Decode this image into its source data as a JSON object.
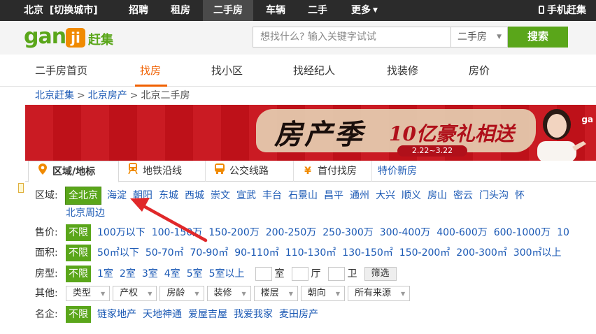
{
  "topbar": {
    "city": "北京",
    "switch_city": "[切换城市]",
    "nav": [
      "招聘",
      "租房",
      "二手房",
      "车辆",
      "二手",
      "更多"
    ],
    "active": "二手房",
    "mobile": "手机赶集"
  },
  "header": {
    "logo_gan": "gan",
    "logo_ji": "ji",
    "logo_name": "赶集",
    "search_placeholder": "想找什么? 输入关键字试试",
    "search_category": "二手房",
    "search_button": "搜索"
  },
  "subnav": {
    "items": [
      "二手房首页",
      "找房",
      "找小区",
      "找经纪人",
      "找装修",
      "房价"
    ],
    "active": "找房"
  },
  "breadcrumb": [
    "北京赶集",
    "北京房产",
    "北京二手房"
  ],
  "banner": {
    "title": "房产季",
    "subtitle": "10亿豪礼相送",
    "dates": "2.22~3.22",
    "brand": "ga"
  },
  "filter_tabs": [
    {
      "label": "区域/地标",
      "icon": "location-pin-icon"
    },
    {
      "label": "地铁沿线",
      "icon": "subway-icon"
    },
    {
      "label": "公交线路",
      "icon": "bus-icon"
    },
    {
      "label": "首付找房",
      "icon": "yen-icon"
    },
    {
      "label": "特价新房",
      "icon": ""
    }
  ],
  "filters": {
    "district": {
      "label": "区域:",
      "selected": "全北京",
      "options": [
        "海淀",
        "朝阳",
        "东城",
        "西城",
        "崇文",
        "宣武",
        "丰台",
        "石景山",
        "昌平",
        "通州",
        "大兴",
        "顺义",
        "房山",
        "密云",
        "门头沟",
        "怀"
      ],
      "extra": "北京周边"
    },
    "price": {
      "label": "售价:",
      "selected": "不限",
      "options": [
        "100万以下",
        "100-150万",
        "150-200万",
        "200-250万",
        "250-300万",
        "300-400万",
        "400-600万",
        "600-1000万",
        "10"
      ]
    },
    "area": {
      "label": "面积:",
      "selected": "不限",
      "options": [
        "50㎡以下",
        "50-70㎡",
        "70-90㎡",
        "90-110㎡",
        "110-130㎡",
        "130-150㎡",
        "150-200㎡",
        "200-300㎡",
        "300㎡以上"
      ]
    },
    "layout": {
      "label": "房型:",
      "selected": "不限",
      "options": [
        "1室",
        "2室",
        "3室",
        "4室",
        "5室",
        "5室以上"
      ],
      "room_unit": "室",
      "hall_unit": "厅",
      "bath_unit": "卫",
      "filter_button": "筛选"
    },
    "other": {
      "label": "其他:",
      "dropdowns": [
        "类型",
        "产权",
        "房龄",
        "装修",
        "楼层",
        "朝向",
        "所有来源"
      ]
    },
    "agency": {
      "label": "名企:",
      "selected": "不限",
      "options": [
        "链家地产",
        "天地神通",
        "爱屋吉屋",
        "我爱我家",
        "麦田房产"
      ]
    }
  },
  "colors": {
    "green": "#5aa61a",
    "orange": "#f06000",
    "link": "#1a58b4",
    "topbar": "#2b2b2b",
    "banner_red": "#c8121a",
    "arrow_red": "#e0282a"
  }
}
